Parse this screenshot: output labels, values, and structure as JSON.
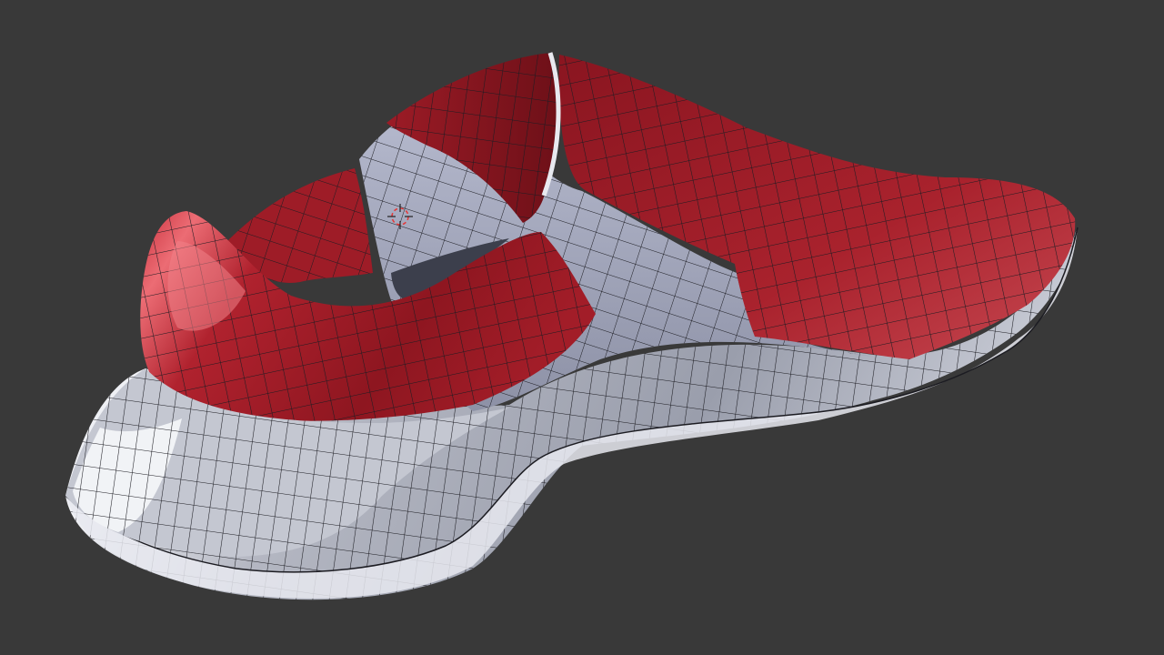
{
  "scene": {
    "subject": "shoe-mesh",
    "view": "3d-viewport",
    "colors": {
      "background": "#393939",
      "upper_red": "#a31f2a",
      "upper_red_dark": "#7a1219",
      "upper_red_light": "#e25a63",
      "sole_gray": "#a9acb8",
      "sole_gray_dark": "#868a98",
      "sole_white": "#e8eaf0",
      "wire": "#1c1c22"
    },
    "icons": [
      "3d-cursor-icon"
    ]
  }
}
